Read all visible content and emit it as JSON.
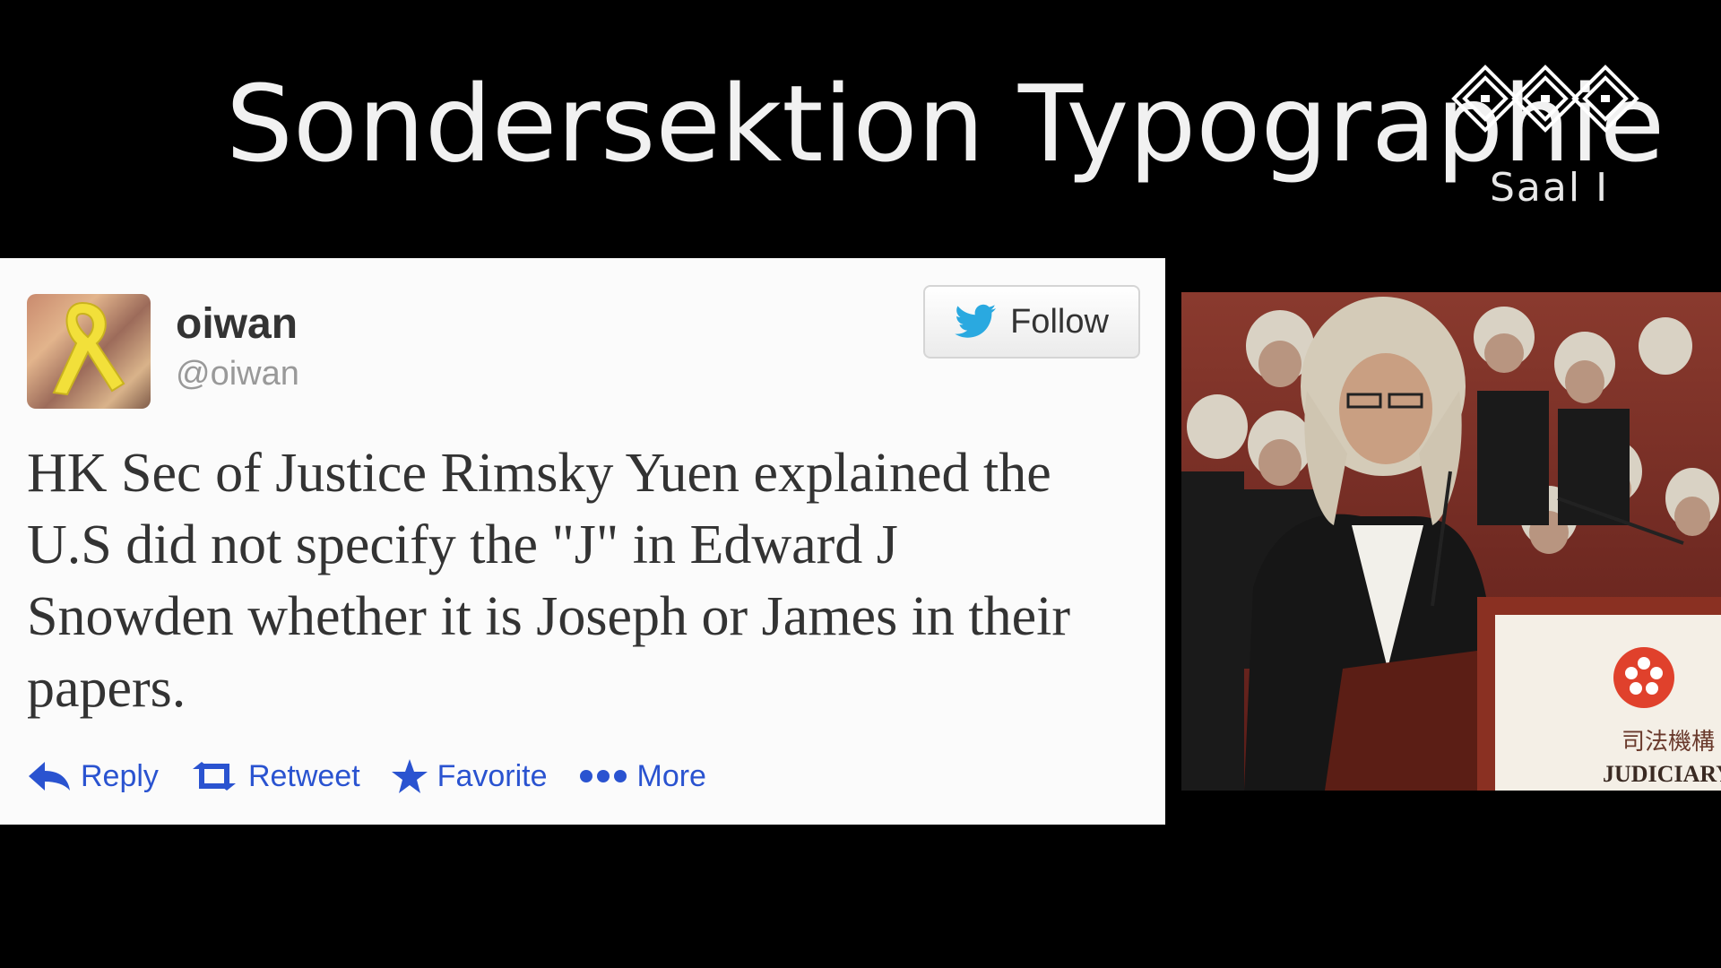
{
  "slide": {
    "title": "Sondersektion Typographie",
    "room": "Saal I"
  },
  "tweet": {
    "author_name": "oiwan",
    "author_handle": "@oiwan",
    "follow_label": "Follow",
    "text": "HK Sec of Justice Rimsky Yuen explained the U.S did not specify the \"J\" in Edward J Snowden whether it is Joseph or James in their papers.",
    "actions": {
      "reply": "Reply",
      "retweet": "Retweet",
      "favorite": "Favorite",
      "more": "More"
    }
  },
  "photo": {
    "podium_text_cn": "司法機構",
    "podium_text_en": "JUDICIARY"
  },
  "colors": {
    "background": "#000000",
    "action_blue": "#2a53d0",
    "twitter_blue": "#2aa9e0"
  }
}
